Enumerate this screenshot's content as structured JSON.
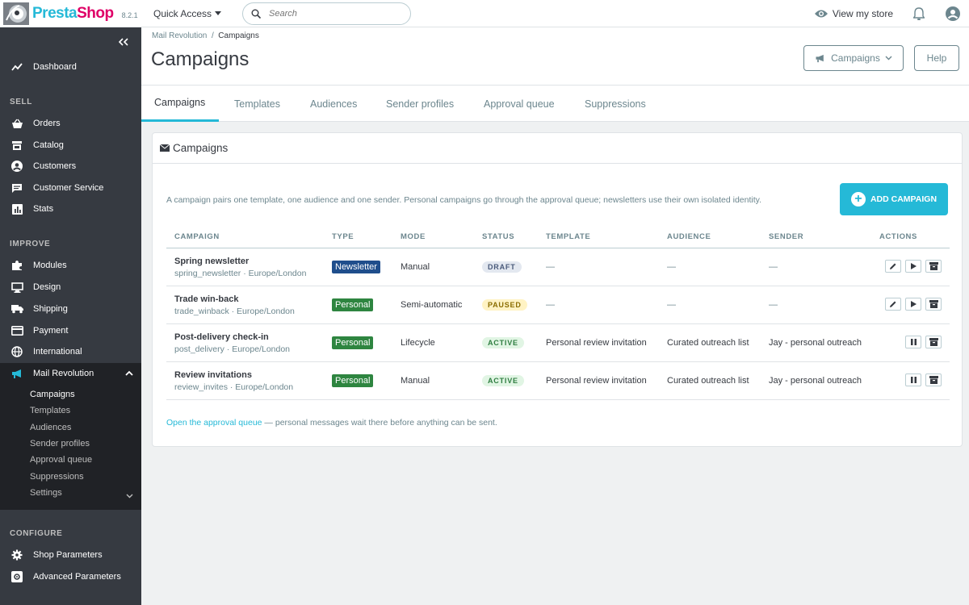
{
  "header": {
    "logo_pre": "Presta",
    "logo_post": "Shop",
    "version": "8.2.1",
    "quick_access": "Quick Access",
    "search_placeholder": "Search",
    "view_store": "View my store"
  },
  "sidebar": {
    "dashboard": "Dashboard",
    "sections": {
      "sell": "SELL",
      "improve": "IMPROVE",
      "configure": "CONFIGURE"
    },
    "sell_items": [
      "Orders",
      "Catalog",
      "Customers",
      "Customer Service",
      "Stats"
    ],
    "improve_items": [
      "Modules",
      "Design",
      "Shipping",
      "Payment",
      "International"
    ],
    "active_item": "Mail Revolution",
    "submenu": [
      "Campaigns",
      "Templates",
      "Audiences",
      "Sender profiles",
      "Approval queue",
      "Suppressions",
      "Settings"
    ],
    "configure_items": [
      "Shop Parameters",
      "Advanced Parameters"
    ]
  },
  "page": {
    "breadcrumb_parent": "Mail Revolution",
    "breadcrumb_sep": "/",
    "breadcrumb_current": "Campaigns",
    "title": "Campaigns",
    "campaigns_button": "Campaigns",
    "help_button": "Help"
  },
  "tabs": [
    "Campaigns",
    "Templates",
    "Audiences",
    "Sender profiles",
    "Approval queue",
    "Suppressions"
  ],
  "card": {
    "title": "Campaigns",
    "intro": "A campaign pairs one template, one audience and one sender. Personal campaigns go through the approval queue; newsletters use their own isolated identity.",
    "add_button": "ADD CAMPAIGN",
    "columns": [
      "CAMPAIGN",
      "TYPE",
      "MODE",
      "STATUS",
      "TEMPLATE",
      "AUDIENCE",
      "SENDER",
      "ACTIONS"
    ],
    "rows": [
      {
        "name": "Spring newsletter",
        "sub": "spring_newsletter · Europe/London",
        "type": "Newsletter",
        "mode": "Manual",
        "status": "DRAFT",
        "template": "—",
        "audience": "—",
        "sender": "—"
      },
      {
        "name": "Trade win-back",
        "sub": "trade_winback · Europe/London",
        "type": "Personal",
        "mode": "Semi-automatic",
        "status": "PAUSED",
        "template": "—",
        "audience": "—",
        "sender": "—"
      },
      {
        "name": "Post-delivery check-in",
        "sub": "post_delivery · Europe/London",
        "type": "Personal",
        "mode": "Lifecycle",
        "status": "ACTIVE",
        "template": "Personal review invitation",
        "audience": "Curated outreach list",
        "sender": "Jay - personal outreach"
      },
      {
        "name": "Review invitations",
        "sub": "review_invites · Europe/London",
        "type": "Personal",
        "mode": "Manual",
        "status": "ACTIVE",
        "template": "Personal review invitation",
        "audience": "Curated outreach list",
        "sender": "Jay - personal outreach"
      }
    ],
    "footer_link": "Open the approval queue",
    "footer_text": " — personal messages wait there before anything can be sent."
  },
  "colors": {
    "accent": "#25b9d7",
    "newsletter_badge": "#1f4e8c",
    "personal_badge": "#2e8540",
    "draft_bg": "#e3e8f0",
    "draft_fg": "#4a5a7a",
    "paused_bg": "#fff3c4",
    "paused_fg": "#8a6d00",
    "active_bg": "#e1f5e4",
    "active_fg": "#2e7d40"
  }
}
